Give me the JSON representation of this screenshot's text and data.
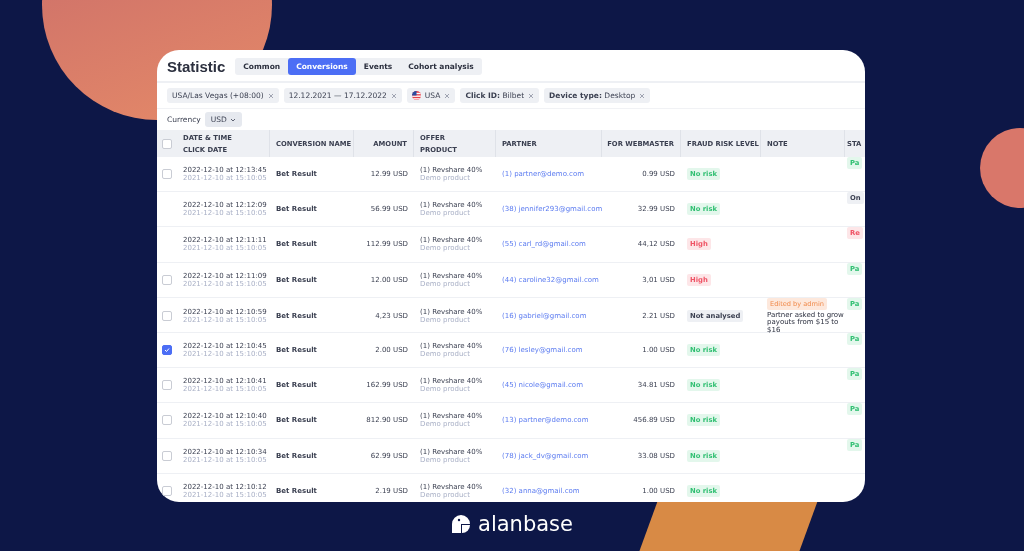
{
  "title": "Statistic",
  "tabs": [
    {
      "label": "Common",
      "selected": false
    },
    {
      "label": "Conversions",
      "selected": true
    },
    {
      "label": "Events",
      "selected": false
    },
    {
      "label": "Cohort analysis",
      "selected": false
    }
  ],
  "filters": [
    {
      "text": "USA/Las Vegas (+08:00)"
    },
    {
      "text": "12.12.2021 — 17.12.2022"
    },
    {
      "text": "USA",
      "flag": true
    },
    {
      "text": "**Click ID:** Bilbet"
    },
    {
      "text": "**Device type:** Desktop"
    }
  ],
  "currency": {
    "label": "Currency",
    "value": "USD"
  },
  "table": {
    "header_checked": false,
    "columns": [
      [
        "DATE & TIME",
        "CLICK DATE"
      ],
      [
        "CONVERSION NAME"
      ],
      [
        "AMOUNT"
      ],
      [
        "OFFER",
        "PRODUCT"
      ],
      [
        "PARTNER"
      ],
      [
        "FOR WEBMASTER"
      ],
      [
        "FRAUD RISK LEVEL"
      ],
      [
        "NOTE"
      ],
      [
        "STA"
      ]
    ],
    "rows": [
      {
        "checked": false,
        "date": "2022-12-10 at 12:13:45",
        "click_date": "2021-12-10 at 15:10:05",
        "name": "Bet Result",
        "amount": "12.99 USD",
        "offer": "(1) Revshare 40%",
        "product": "Demo product",
        "partner": "(1) partner@demo.com",
        "webmaster": "0.99 USD",
        "risk": {
          "text": "No risk",
          "kind": "low"
        },
        "status": {
          "text": "Pa",
          "kind": "green"
        }
      },
      {
        "date": "2022-12-10 at 12:12:09",
        "click_date": "2021-12-10 at 15:10:05",
        "name": "Bet Result",
        "amount": "56.99 USD",
        "offer": "(1) Revshare 40%",
        "product": "Demo product",
        "partner": "(38) jennifer293@gmail.com",
        "webmaster": "32.99 USD",
        "risk": {
          "text": "No risk",
          "kind": "low"
        },
        "status": {
          "text": "On",
          "kind": "grey"
        }
      },
      {
        "date": "2022-12-10 at 12:11:11",
        "click_date": "2021-12-10 at 15:10:05",
        "name": "Bet Result",
        "amount": "112.99 USD",
        "offer": "(1) Revshare 40%",
        "product": "Demo product",
        "partner": "(55) carl_rd@gmail.com",
        "webmaster": "44,12 USD",
        "risk": {
          "text": "High",
          "kind": "high"
        },
        "status": {
          "text": "Re",
          "kind": "red"
        }
      },
      {
        "checked": false,
        "date": "2022-12-10 at 12:11:09",
        "click_date": "2021-12-10 at 15:10:05",
        "name": "Bet Result",
        "amount": "12.00 USD",
        "offer": "(1) Revshare 40%",
        "product": "Demo product",
        "partner": "(44) caroline32@gmail.com",
        "webmaster": "3,01 USD",
        "risk": {
          "text": "High",
          "kind": "high"
        },
        "status": {
          "text": "Pa",
          "kind": "green"
        }
      },
      {
        "checked": false,
        "date": "2022-12-10 at 12:10:59",
        "click_date": "2021-12-10 at 15:10:05",
        "name": "Bet Result",
        "amount": "4,23 USD",
        "offer": "(1) Revshare 40%",
        "product": "Demo product",
        "partner": "(16) gabriel@gmail.com",
        "webmaster": "2.21 USD",
        "risk": {
          "text": "Not analysed",
          "kind": "none"
        },
        "note": {
          "tag": "Edited by admin",
          "text": "Partner asked to grow payouts from $15 to $16"
        },
        "status": {
          "text": "Pa",
          "kind": "green"
        }
      },
      {
        "checked": true,
        "date": "2022-12-10 at 12:10:45",
        "click_date": "2021-12-10 at 15:10:05",
        "name": "Bet Result",
        "amount": "2.00 USD",
        "offer": "(1) Revshare 40%",
        "product": "Demo product",
        "partner": "(76) lesley@gmail.com",
        "webmaster": "1.00 USD",
        "risk": {
          "text": "No risk",
          "kind": "low"
        },
        "status": {
          "text": "Pa",
          "kind": "green"
        }
      },
      {
        "checked": false,
        "date": "2022-12-10 at 12:10:41",
        "click_date": "2021-12-10 at 15:10:05",
        "name": "Bet Result",
        "amount": "162.99 USD",
        "offer": "(1) Revshare 40%",
        "product": "Demo product",
        "partner": "(45) nicole@gmail.com",
        "webmaster": "34.81 USD",
        "risk": {
          "text": "No risk",
          "kind": "low"
        },
        "status": {
          "text": "Pa",
          "kind": "green"
        }
      },
      {
        "checked": false,
        "date": "2022-12-10 at 12:10:40",
        "click_date": "2021-12-10 at 15:10:05",
        "name": "Bet Result",
        "amount": "812.90 USD",
        "offer": "(1) Revshare 40%",
        "product": "Demo product",
        "partner": "(13) partner@demo.com",
        "webmaster": "456.89 USD",
        "risk": {
          "text": "No risk",
          "kind": "low"
        },
        "status": {
          "text": "Pa",
          "kind": "green"
        }
      },
      {
        "checked": false,
        "date": "2022-12-10 at 12:10:34",
        "click_date": "2021-12-10 at 15:10:05",
        "name": "Bet Result",
        "amount": "62.99 USD",
        "offer": "(1) Revshare 40%",
        "product": "Demo product",
        "partner": "(78) jack_dv@gmail.com",
        "webmaster": "33.08 USD",
        "risk": {
          "text": "No risk",
          "kind": "low"
        },
        "status": {
          "text": "Pa",
          "kind": "green"
        }
      },
      {
        "checked": false,
        "date": "2022-12-10 at 12:10:12",
        "click_date": "2021-12-10 at 15:10:05",
        "name": "Bet Result",
        "amount": "2.19 USD",
        "offer": "(1) Revshare 40%",
        "product": "Demo product",
        "partner": "(32) anna@gmail.com",
        "webmaster": "1.00 USD",
        "risk": {
          "text": "No risk",
          "kind": "low"
        }
      }
    ]
  },
  "brand": "alanbase"
}
